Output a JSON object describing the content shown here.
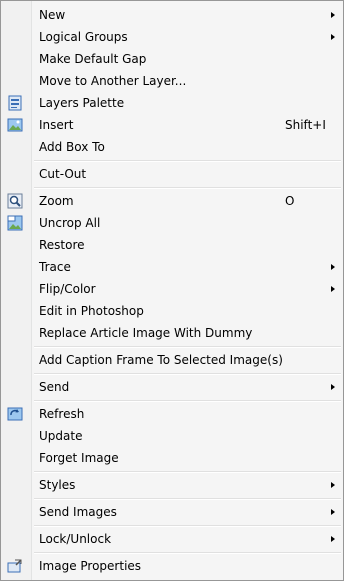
{
  "menu": {
    "items": [
      {
        "label": "New",
        "submenu": true
      },
      {
        "label": "Logical Groups",
        "submenu": true
      },
      {
        "label": "Make Default Gap"
      },
      {
        "label": "Move to Another Layer..."
      },
      {
        "label": "Layers Palette",
        "icon": "layers-palette-icon"
      },
      {
        "label": "Insert",
        "shortcut": "Shift+I",
        "icon": "insert-image-icon"
      },
      {
        "label": "Add Box To"
      },
      {
        "label": "Cut-Out"
      },
      {
        "label": "Zoom",
        "shortcut": "O",
        "icon": "zoom-icon"
      },
      {
        "label": "Uncrop All",
        "icon": "uncrop-icon"
      },
      {
        "label": "Restore"
      },
      {
        "label": "Trace",
        "submenu": true
      },
      {
        "label": "Flip/Color",
        "submenu": true
      },
      {
        "label": "Edit in Photoshop"
      },
      {
        "label": "Replace Article Image With Dummy"
      },
      {
        "label": "Add Caption Frame To Selected Image(s)"
      },
      {
        "label": "Send",
        "submenu": true
      },
      {
        "label": "Refresh",
        "icon": "refresh-icon"
      },
      {
        "label": "Update"
      },
      {
        "label": "Forget Image"
      },
      {
        "label": "Styles",
        "submenu": true
      },
      {
        "label": "Send Images",
        "submenu": true
      },
      {
        "label": "Lock/Unlock",
        "submenu": true
      },
      {
        "label": "Image Properties",
        "icon": "image-properties-icon"
      }
    ]
  }
}
